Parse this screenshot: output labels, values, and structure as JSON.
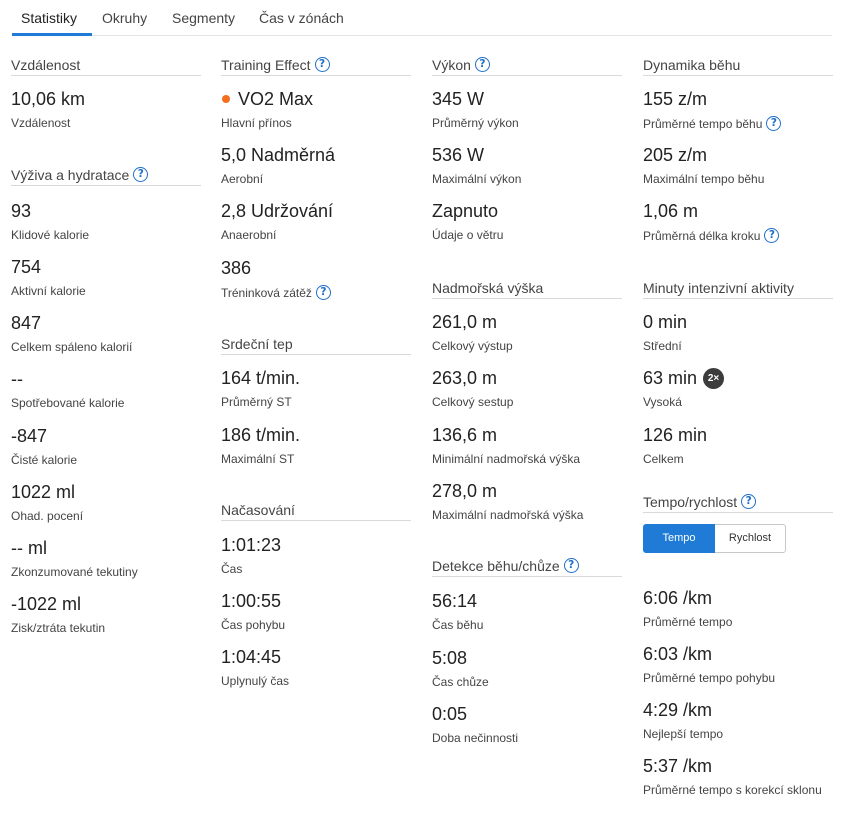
{
  "tabs": [
    "Statistiky",
    "Okruhy",
    "Segmenty",
    "Čas v zónách"
  ],
  "active_tab": "Statistiky",
  "colors": {
    "accent": "#1f7bd6",
    "primary_benefit_dot": "#f46e1e",
    "badge": "#3c3c3c"
  },
  "col1": {
    "distance": {
      "title": "Vzdálenost",
      "stats": [
        {
          "value": "10,06 km",
          "label": "Vzdálenost"
        }
      ]
    },
    "nutrition": {
      "title": "Výživa a hydratace",
      "stats": [
        {
          "value": "93",
          "label": "Klidové kalorie"
        },
        {
          "value": "754",
          "label": "Aktivní kalorie"
        },
        {
          "value": "847",
          "label": "Celkem spáleno kalorií"
        },
        {
          "value": "--",
          "label": "Spotřebované kalorie"
        },
        {
          "value": "-847",
          "label": "Čisté kalorie"
        },
        {
          "value": "1022 ml",
          "label": "Ohad. pocení"
        },
        {
          "value": "-- ml",
          "label": "Zkonzumované tekutiny"
        },
        {
          "value": "-1022 ml",
          "label": "Zisk/ztráta tekutin"
        }
      ]
    }
  },
  "col2": {
    "training": {
      "title": "Training Effect",
      "stats": [
        {
          "value": "VO2 Max",
          "label": "Hlavní přínos"
        },
        {
          "value": "5,0 Nadměrná",
          "label": "Aerobní"
        },
        {
          "value": "2,8 Udržování",
          "label": "Anaerobní"
        },
        {
          "value": "386",
          "label": "Tréninková zátěž"
        }
      ]
    },
    "heart": {
      "title": "Srdeční tep",
      "stats": [
        {
          "value": "164 t/min.",
          "label": "Průměrný ST"
        },
        {
          "value": "186 t/min.",
          "label": "Maximální ST"
        }
      ]
    },
    "timing": {
      "title": "Načasování",
      "stats": [
        {
          "value": "1:01:23",
          "label": "Čas"
        },
        {
          "value": "1:00:55",
          "label": "Čas pohybu"
        },
        {
          "value": "1:04:45",
          "label": "Uplynulý čas"
        }
      ]
    }
  },
  "col3": {
    "power": {
      "title": "Výkon",
      "stats": [
        {
          "value": "345 W",
          "label": "Průměrný výkon"
        },
        {
          "value": "536 W",
          "label": "Maximální výkon"
        },
        {
          "value": "Zapnuto",
          "label": "Údaje o větru"
        }
      ]
    },
    "elevation": {
      "title": "Nadmořská výška",
      "stats": [
        {
          "value": "261,0 m",
          "label": "Celkový výstup"
        },
        {
          "value": "263,0 m",
          "label": "Celkový sestup"
        },
        {
          "value": "136,6 m",
          "label": "Minimální nadmořská výška"
        },
        {
          "value": "278,0 m",
          "label": "Maximální nadmořská výška"
        }
      ]
    },
    "runwalk": {
      "title": "Detekce běhu/chůze",
      "stats": [
        {
          "value": "56:14",
          "label": "Čas běhu"
        },
        {
          "value": "5:08",
          "label": "Čas chůze"
        },
        {
          "value": "0:05",
          "label": "Doba nečinnosti"
        }
      ]
    }
  },
  "col4": {
    "dynamics": {
      "title": "Dynamika běhu",
      "stats": [
        {
          "value": "155 z/m",
          "label": "Průměrné tempo běhu"
        },
        {
          "value": "205 z/m",
          "label": "Maximální tempo běhu"
        },
        {
          "value": "1,06 m",
          "label": "Průměrná délka kroku"
        }
      ]
    },
    "intensity": {
      "title": "Minuty intenzivní aktivity",
      "stats": [
        {
          "value": "0 min",
          "label": "Střední"
        },
        {
          "value": "63 min",
          "label": "Vysoká",
          "badge": "2×"
        },
        {
          "value": "126 min",
          "label": "Celkem"
        }
      ]
    },
    "pace": {
      "title": "Tempo/rychlost",
      "toggle": {
        "on": "Tempo",
        "off": "Rychlost"
      },
      "stats": [
        {
          "value": "6:06 /km",
          "label": "Průměrné tempo"
        },
        {
          "value": "6:03 /km",
          "label": "Průměrné tempo pohybu"
        },
        {
          "value": "4:29 /km",
          "label": "Nejlepší tempo"
        },
        {
          "value": "5:37 /km",
          "label": "Průměrné tempo s korekcí sklonu"
        }
      ]
    }
  }
}
